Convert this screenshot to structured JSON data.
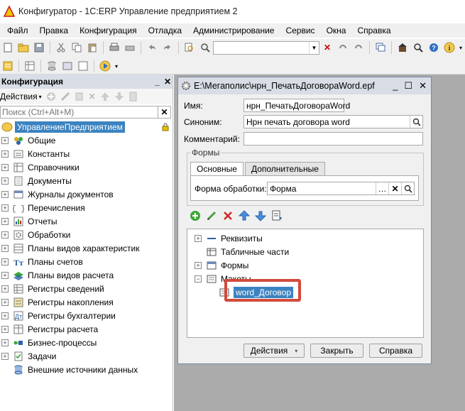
{
  "window": {
    "title": "Конфигуратор - 1С:ERP Управление предприятием 2"
  },
  "menu": [
    "Файл",
    "Правка",
    "Конфигурация",
    "Отладка",
    "Администрирование",
    "Сервис",
    "Окна",
    "Справка"
  ],
  "left_panel": {
    "title": "Конфигурация",
    "actions_label": "Действия",
    "search_placeholder": "Поиск (Ctrl+Alt+M)",
    "root": "УправлениеПредприятием",
    "items": [
      {
        "label": "Общие",
        "icon": "common-icon",
        "expander": true
      },
      {
        "label": "Константы",
        "icon": "constants-icon",
        "expander": true
      },
      {
        "label": "Справочники",
        "icon": "catalogs-icon",
        "expander": true
      },
      {
        "label": "Документы",
        "icon": "documents-icon",
        "expander": true
      },
      {
        "label": "Журналы документов",
        "icon": "journals-icon",
        "expander": true
      },
      {
        "label": "Перечисления",
        "icon": "enums-icon",
        "expander": true
      },
      {
        "label": "Отчеты",
        "icon": "reports-icon",
        "expander": true
      },
      {
        "label": "Обработки",
        "icon": "dataprocessors-icon",
        "expander": true
      },
      {
        "label": "Планы видов характеристик",
        "icon": "chart-of-characteristics-icon",
        "expander": true
      },
      {
        "label": "Планы счетов",
        "icon": "chart-of-accounts-icon",
        "expander": true
      },
      {
        "label": "Планы видов расчета",
        "icon": "chart-of-calculation-icon",
        "expander": true
      },
      {
        "label": "Регистры сведений",
        "icon": "info-registers-icon",
        "expander": true
      },
      {
        "label": "Регистры накопления",
        "icon": "accum-registers-icon",
        "expander": true
      },
      {
        "label": "Регистры бухгалтерии",
        "icon": "accounting-registers-icon",
        "expander": true
      },
      {
        "label": "Регистры расчета",
        "icon": "calc-registers-icon",
        "expander": true
      },
      {
        "label": "Бизнес-процессы",
        "icon": "business-processes-icon",
        "expander": true
      },
      {
        "label": "Задачи",
        "icon": "tasks-icon",
        "expander": true
      },
      {
        "label": "Внешние источники данных",
        "icon": "external-sources-icon",
        "expander": false
      }
    ]
  },
  "dialog": {
    "title": "E:\\Мегаполис\\нрн_ПечатьДоговораWord.epf",
    "name_label": "Имя:",
    "name_value": "нрн_ПечатьДоговораWord",
    "synonym_label": "Синоним:",
    "synonym_value": "Нрн печать договора word",
    "comment_label": "Комментарий:",
    "comment_value": "",
    "forms_group": "Формы",
    "tab_main": "Основные",
    "tab_extra": "Дополнительные",
    "form_label": "Форма обработки:",
    "form_value": "Форма",
    "tree": {
      "requisites": "Реквизиты",
      "tabular": "Табличные части",
      "forms": "Формы",
      "templates": "Макеты",
      "template_item": "word_Договор"
    },
    "btn_actions": "Действия",
    "btn_close": "Закрыть",
    "btn_help": "Справка"
  }
}
